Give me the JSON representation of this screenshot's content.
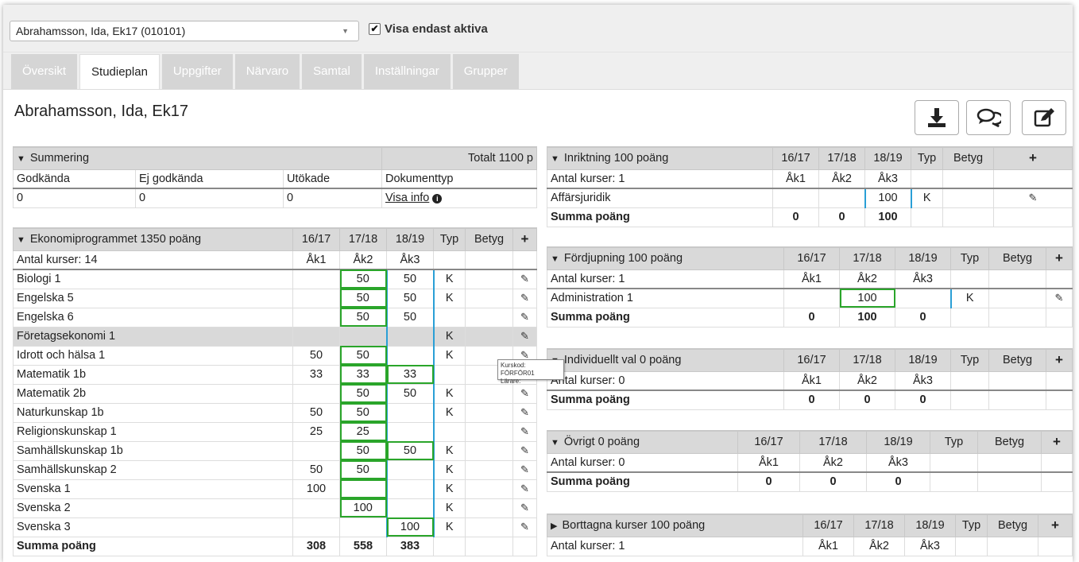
{
  "header": {
    "student_select": "Abrahamsson, Ida, Ek17 (010101)",
    "active_only_label": "Visa endast aktiva"
  },
  "tabs": [
    {
      "label": "Översikt"
    },
    {
      "label": "Studieplan"
    },
    {
      "label": "Uppgifter"
    },
    {
      "label": "Närvaro"
    },
    {
      "label": "Samtal"
    },
    {
      "label": "Inställningar"
    },
    {
      "label": "Grupper"
    }
  ],
  "page_title": "Abrahamsson, Ida, Ek17",
  "summary": {
    "title": "Summering",
    "total": "Totalt 1100 p",
    "cols": [
      "Godkända",
      "Ej godkända",
      "Utökade",
      "Dokumenttyp"
    ],
    "values": [
      "0",
      "0",
      "0"
    ],
    "info_link": "Visa info"
  },
  "ekonomi": {
    "title": "Ekonomiprogrammet 1350 poäng",
    "years": [
      "16/17",
      "17/18",
      "18/19"
    ],
    "typ": "Typ",
    "betyg": "Betyg",
    "count": "Antal kurser: 14",
    "ak": [
      "Åk1",
      "Åk2",
      "Åk3"
    ],
    "rows": [
      [
        "Biologi 1",
        "",
        "50",
        "50",
        "K"
      ],
      [
        "Engelska 5",
        "",
        "50",
        "50",
        "K"
      ],
      [
        "Engelska 6",
        "",
        "50",
        "50",
        ""
      ],
      [
        "Företagsekonomi 1",
        "",
        "",
        "",
        "K"
      ],
      [
        "Idrott och hälsa 1",
        "50",
        "50",
        "",
        "K"
      ],
      [
        "Matematik 1b",
        "33",
        "33",
        "33",
        ""
      ],
      [
        "Matematik 2b",
        "",
        "50",
        "50",
        "K"
      ],
      [
        "Naturkunskap 1b",
        "50",
        "50",
        "",
        "K"
      ],
      [
        "Religionskunskap 1",
        "25",
        "25",
        "",
        ""
      ],
      [
        "Samhällskunskap 1b",
        "",
        "50",
        "50",
        "K"
      ],
      [
        "Samhällskunskap 2",
        "50",
        "50",
        "",
        "K"
      ],
      [
        "Svenska 1",
        "100",
        "",
        "",
        "K"
      ],
      [
        "Svenska 2",
        "",
        "100",
        "",
        "K"
      ],
      [
        "Svenska 3",
        "",
        "",
        "100",
        "K"
      ]
    ],
    "sum_label": "Summa poäng",
    "sums": [
      "308",
      "558",
      "383"
    ]
  },
  "inriktning": {
    "title": "Inriktning 100 poäng",
    "count": "Antal kurser: 1",
    "row": [
      "Affärsjuridik",
      "",
      "",
      "100",
      "K"
    ],
    "sum_label": "Summa poäng",
    "sums": [
      "0",
      "0",
      "100"
    ]
  },
  "fordjupning": {
    "title": "Fördjupning 100 poäng",
    "count": "Antal kurser: 1",
    "row": [
      "Administration 1",
      "",
      "100",
      "",
      "K"
    ],
    "sum_label": "Summa poäng",
    "sums": [
      "0",
      "100",
      "0"
    ]
  },
  "individuellt": {
    "title": "Individuellt val 0 poäng",
    "count": "Antal kurser: 0",
    "sum_label": "Summa poäng",
    "sums": [
      "0",
      "0",
      "0"
    ]
  },
  "ovrigt": {
    "title": "Övrigt 0 poäng",
    "count": "Antal kurser: 0",
    "sum_label": "Summa poäng",
    "sums": [
      "0",
      "0",
      "0"
    ]
  },
  "borttagna": {
    "title": "Borttagna kurser 100 poäng",
    "count": "Antal kurser: 1"
  },
  "tooltip": {
    "line1": "Kurskod: FÖRFÖR01",
    "line2": "Lärare:"
  },
  "icons": {
    "download": "download-icon",
    "chat": "chat-icon",
    "edit": "edit-icon",
    "chevron_down": "chevron-down-icon",
    "chevron_right": "chevron-right-icon",
    "plus": "plus-icon",
    "info": "info-icon"
  },
  "colors": {
    "accent_border": "#d6337a",
    "green_highlight": "#2aa52a",
    "blue_divider": "#2a9fd6"
  }
}
